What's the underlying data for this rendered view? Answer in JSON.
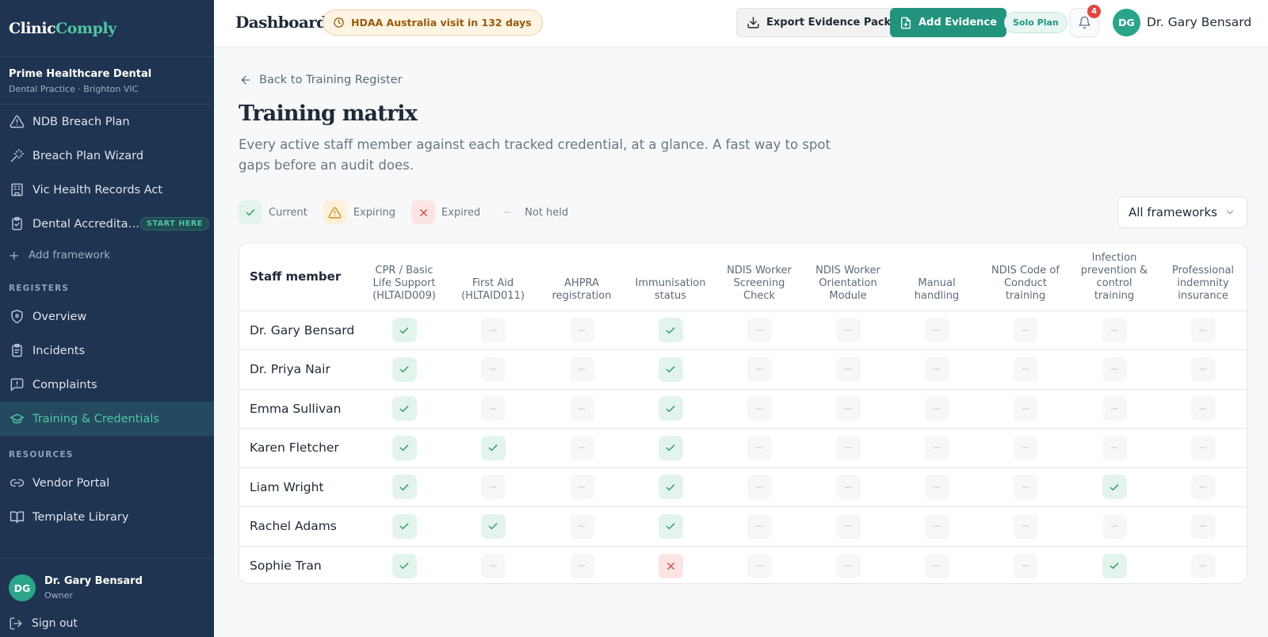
{
  "brand": {
    "part1": "Clinic",
    "part2": "Comply"
  },
  "practice": {
    "name": "Prime Healthcare Dental",
    "sub": "Dental Practice · Brighton VIC"
  },
  "frameworks": [
    {
      "label": "NDB Breach Plan",
      "icon": "alert-triangle-icon"
    },
    {
      "label": "Breach Plan Wizard",
      "icon": "magic-wand-icon"
    },
    {
      "label": "Vic Health Records Act",
      "icon": "building-icon"
    },
    {
      "label": "Dental Accreditation",
      "display": "Dental Accredita…",
      "icon": "clipboard-check-icon",
      "badge": "START HERE"
    }
  ],
  "add_framework": "Add framework",
  "registers_label": "REGISTERS",
  "registers": [
    {
      "label": "Overview",
      "icon": "shield-icon"
    },
    {
      "label": "Incidents",
      "icon": "clipboard-icon"
    },
    {
      "label": "Complaints",
      "icon": "message-square-icon"
    },
    {
      "label": "Training & Credentials",
      "icon": "graduation-cap-icon",
      "active": true
    }
  ],
  "resources_label": "RESOURCES",
  "resources": [
    {
      "label": "Vendor Portal",
      "icon": "link-icon"
    },
    {
      "label": "Template Library",
      "icon": "book-open-icon"
    }
  ],
  "user": {
    "initials": "DG",
    "name": "Dr. Gary Bensard",
    "role": "Owner"
  },
  "signout": "Sign out",
  "topbar": {
    "title": "Dashboard",
    "visit": "HDAA Australia visit in 132 days",
    "export": "Export Evidence Pack",
    "add": "Add Evidence",
    "plan": "Solo Plan",
    "notifications": "4",
    "user_initials": "DG",
    "user_name": "Dr. Gary Bensard"
  },
  "main": {
    "back": "Back to Training Register",
    "title": "Training matrix",
    "description": "Every active staff member against each tracked credential, at a glance. A fast way to spot gaps before an audit does.",
    "legend": [
      {
        "label": "Current",
        "status": "current"
      },
      {
        "label": "Expiring",
        "status": "expiring"
      },
      {
        "label": "Expired",
        "status": "expired"
      },
      {
        "label": "Not held",
        "status": "none"
      }
    ],
    "filter": "All frameworks"
  },
  "matrix": {
    "staff_header": "Staff member",
    "columns": [
      [
        "CPR / Basic",
        "Life Support",
        "(HLTAID009)"
      ],
      [
        "First Aid",
        "(HLTAID011)"
      ],
      [
        "AHPRA",
        "registration"
      ],
      [
        "Immunisation",
        "status"
      ],
      [
        "NDIS Worker",
        "Screening",
        "Check"
      ],
      [
        "NDIS Worker",
        "Orientation",
        "Module"
      ],
      [
        "Manual",
        "handling"
      ],
      [
        "NDIS Code of",
        "Conduct",
        "training"
      ],
      [
        "Infection",
        "prevention &",
        "control",
        "training"
      ],
      [
        "Professional",
        "indemnity",
        "insurance"
      ]
    ],
    "rows": [
      {
        "name": "Dr. Gary Bensard",
        "cells": [
          "current",
          "none",
          "none",
          "current",
          "none",
          "none",
          "none",
          "none",
          "none",
          "none"
        ]
      },
      {
        "name": "Dr. Priya Nair",
        "cells": [
          "current",
          "none",
          "none",
          "current",
          "none",
          "none",
          "none",
          "none",
          "none",
          "none"
        ]
      },
      {
        "name": "Emma Sullivan",
        "cells": [
          "current",
          "none",
          "none",
          "current",
          "none",
          "none",
          "none",
          "none",
          "none",
          "none"
        ]
      },
      {
        "name": "Karen Fletcher",
        "cells": [
          "current",
          "current",
          "none",
          "current",
          "none",
          "none",
          "none",
          "none",
          "none",
          "none"
        ]
      },
      {
        "name": "Liam Wright",
        "cells": [
          "current",
          "none",
          "none",
          "current",
          "none",
          "none",
          "none",
          "none",
          "current",
          "none"
        ]
      },
      {
        "name": "Rachel Adams",
        "cells": [
          "current",
          "current",
          "none",
          "current",
          "none",
          "none",
          "none",
          "none",
          "none",
          "none"
        ]
      },
      {
        "name": "Sophie Tran",
        "cells": [
          "current",
          "none",
          "none",
          "expired",
          "none",
          "none",
          "none",
          "none",
          "current",
          "none"
        ]
      }
    ]
  }
}
